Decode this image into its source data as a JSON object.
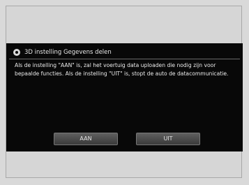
{
  "dialog": {
    "title": "3D instelling Gegevens delen",
    "message": "Als de instelling \"AAN\" is, zal het voertuig data uploaden die nodig zijn voor bepaalde functies. Als de instelling \"UIT\" is, stopt de auto de datacommunicatie.",
    "buttons": {
      "on_label": "AAN",
      "off_label": "UIT"
    }
  },
  "icons": {
    "title_icon": "settings-icon"
  },
  "colors": {
    "screen_background": "#080808",
    "text": "#ececec",
    "button": "#4a4a4a"
  }
}
